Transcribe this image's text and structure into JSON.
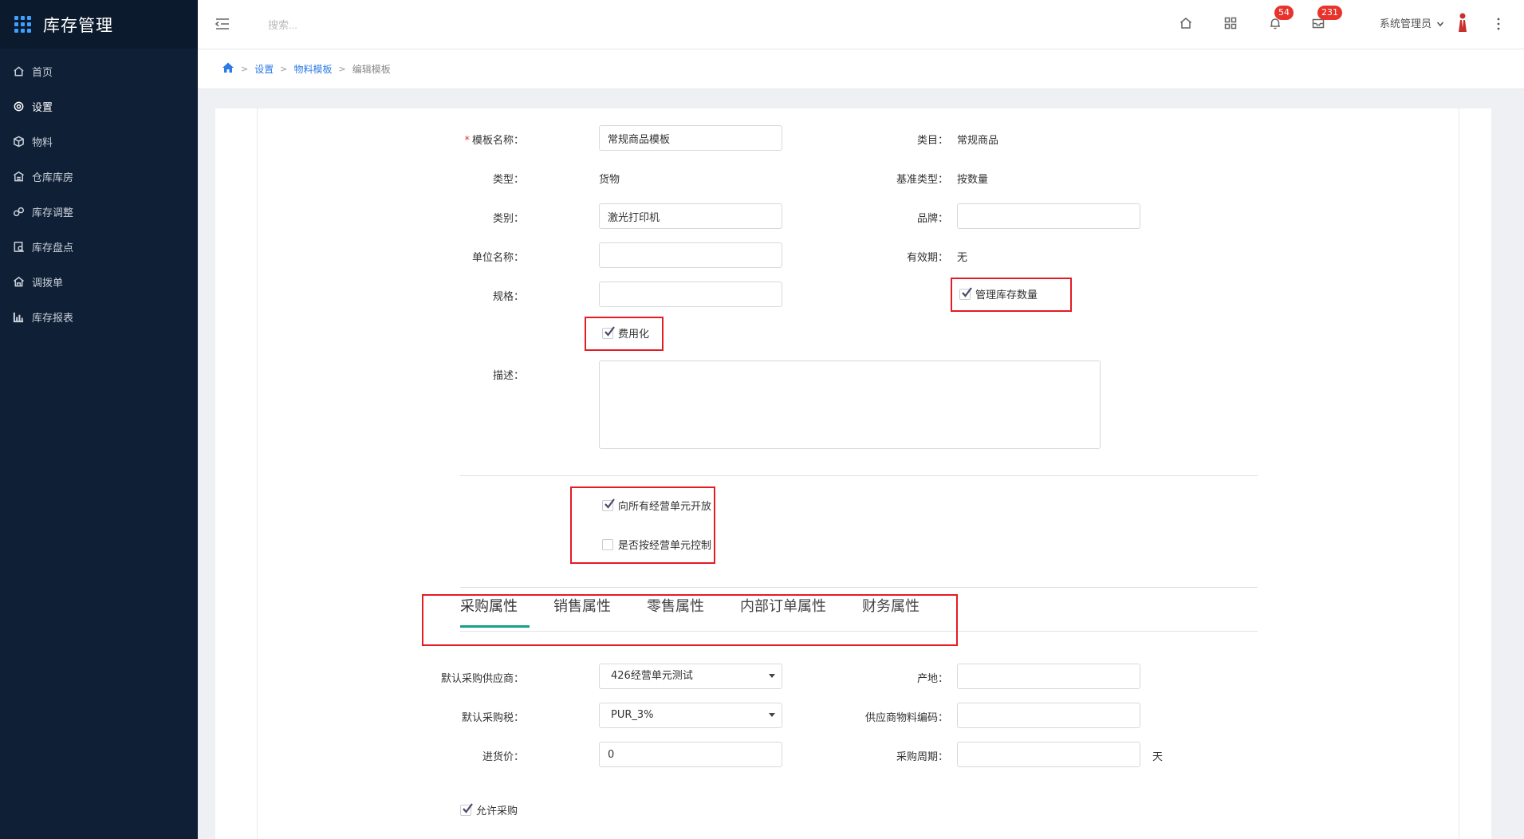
{
  "app": {
    "title": "库存管理"
  },
  "sidebar": {
    "items": [
      {
        "label": "首页",
        "icon": "home-icon"
      },
      {
        "label": "设置",
        "icon": "gear-icon",
        "active": true
      },
      {
        "label": "物料",
        "icon": "cube-icon"
      },
      {
        "label": "仓库库房",
        "icon": "warehouse-icon"
      },
      {
        "label": "库存调整",
        "icon": "adjust-icon"
      },
      {
        "label": "库存盘点",
        "icon": "inventory-check-icon"
      },
      {
        "label": "调拨单",
        "icon": "transfer-icon"
      },
      {
        "label": "库存报表",
        "icon": "bar-chart-icon"
      }
    ]
  },
  "header": {
    "search_placeholder": "搜索...",
    "notifications_count": "54",
    "messages_count": "231",
    "user_name": "系统管理员"
  },
  "breadcrumb": {
    "items": [
      "设置",
      "物料模板"
    ],
    "current": "编辑模板"
  },
  "form": {
    "template_name": {
      "label": "模板名称：",
      "value": "常规商品模板"
    },
    "category_class": {
      "label": "类目：",
      "value": "常规商品"
    },
    "type": {
      "label": "类型：",
      "value": "货物"
    },
    "base_type": {
      "label": "基准类型：",
      "value": "按数量"
    },
    "category": {
      "label": "类别：",
      "value": "激光打印机"
    },
    "brand": {
      "label": "品牌：",
      "value": ""
    },
    "unit_name": {
      "label": "单位名称：",
      "value": ""
    },
    "validity": {
      "label": "有效期：",
      "value": "无"
    },
    "spec": {
      "label": "规格：",
      "value": ""
    },
    "manage_stock": {
      "label": "管理库存数量",
      "checked": true
    },
    "expense": {
      "label": "费用化",
      "checked": true
    },
    "description": {
      "label": "描述：",
      "value": ""
    },
    "open_to_all_units": {
      "label": "向所有经营单元开放",
      "checked": true
    },
    "control_by_unit": {
      "label": "是否按经营单元控制",
      "checked": false
    }
  },
  "tabs": [
    "采购属性",
    "销售属性",
    "零售属性",
    "内部订单属性",
    "财务属性"
  ],
  "purchase": {
    "default_supplier": {
      "label": "默认采购供应商：",
      "value": "426经营单元测试"
    },
    "origin": {
      "label": "产地：",
      "value": ""
    },
    "default_tax": {
      "label": "默认采购税：",
      "value": "PUR_3%"
    },
    "supplier_code": {
      "label": "供应商物料编码：",
      "value": ""
    },
    "purchase_price": {
      "label": "进货价：",
      "value": "0"
    },
    "purchase_cycle": {
      "label": "采购周期：",
      "value": "",
      "unit": "天"
    },
    "allow_purchase": {
      "label": "允许采购",
      "checked": true
    }
  },
  "colors": {
    "sidebar_bg": "#0f1f35",
    "accent": "#2c7be5",
    "tab_active": "#17a085",
    "highlight": "#e41c23",
    "badge": "#e8332c"
  }
}
